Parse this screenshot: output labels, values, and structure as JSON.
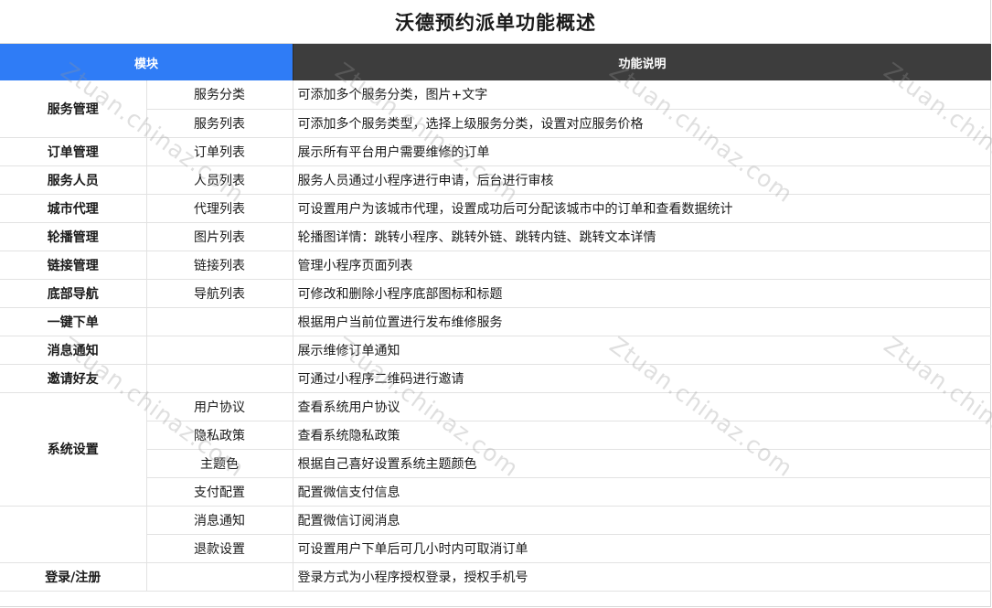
{
  "title": "沃德预约派单功能概述",
  "header": {
    "module": "模块",
    "description": "功能说明"
  },
  "rows": [
    {
      "module": "服务管理",
      "span": 2,
      "sub": "服务分类",
      "desc": "可添加多个服务分类，图片+文字"
    },
    {
      "sub": "服务列表",
      "desc": "可添加多个服务类型，选择上级服务分类，设置对应服务价格"
    },
    {
      "module": "订单管理",
      "span": 1,
      "sub": "订单列表",
      "desc": "展示所有平台用户需要维修的订单"
    },
    {
      "module": "服务人员",
      "span": 1,
      "sub": "人员列表",
      "desc": "服务人员通过小程序进行申请，后台进行审核"
    },
    {
      "module": "城市代理",
      "span": 1,
      "sub": "代理列表",
      "desc": "可设置用户为该城市代理，设置成功后可分配该城市中的订单和查看数据统计"
    },
    {
      "module": "轮播管理",
      "span": 1,
      "sub": "图片列表",
      "desc": "轮播图详情：跳转小程序、跳转外链、跳转内链、跳转文本详情"
    },
    {
      "module": "链接管理",
      "span": 1,
      "sub": "链接列表",
      "desc": "管理小程序页面列表"
    },
    {
      "module": "底部导航",
      "span": 1,
      "sub": "导航列表",
      "desc": "可修改和删除小程序底部图标和标题"
    },
    {
      "module": "一键下单",
      "span": 1,
      "sub": "",
      "desc": "根据用户当前位置进行发布维修服务"
    },
    {
      "module": "消息通知",
      "span": 1,
      "sub": "",
      "desc": "展示维修订单通知"
    },
    {
      "module": "邀请好友",
      "span": 1,
      "sub": "",
      "desc": "可通过小程序二维码进行邀请"
    },
    {
      "module": "系统设置",
      "span": 4,
      "sub": "用户协议",
      "desc": "查看系统用户协议"
    },
    {
      "sub": "隐私政策",
      "desc": "查看系统隐私政策"
    },
    {
      "sub": "主题色",
      "desc": "根据自己喜好设置系统主题颜色"
    },
    {
      "sub": "支付配置",
      "desc": "配置微信支付信息"
    },
    {
      "module": "",
      "span": 2,
      "sub": "消息通知",
      "desc": "配置微信订阅消息"
    },
    {
      "sub": "退款设置",
      "desc": "可设置用户下单后可几小时内可取消订单"
    },
    {
      "module": "登录/注册",
      "span": 1,
      "sub": "",
      "desc": "登录方式为小程序授权登录，授权手机号"
    }
  ],
  "watermark": "Ztuan.chinaz.com",
  "colors": {
    "module_header": "#2f7cf6",
    "desc_header": "#3d3d3d"
  }
}
